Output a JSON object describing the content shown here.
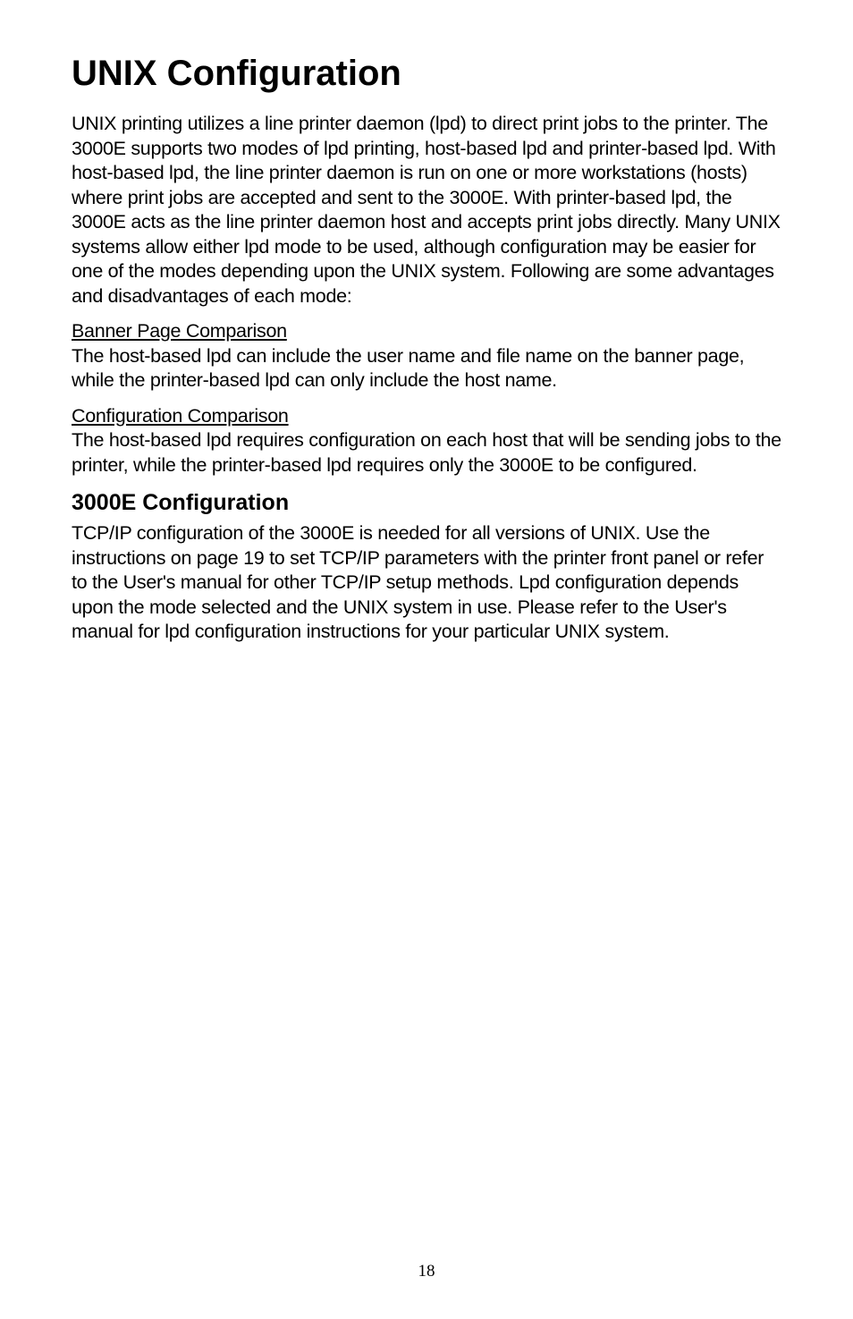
{
  "title": "UNIX Configuration",
  "intro": "UNIX printing utilizes a line printer daemon (lpd) to direct print jobs to the printer.  The 3000E supports two modes of lpd printing, host-based lpd and printer-based lpd.  With host-based lpd, the line printer daemon is run on one or more workstations (hosts) where print jobs are accepted and sent to the 3000E.  With printer-based lpd, the 3000E acts as the line printer daemon host and accepts print jobs directly.  Many UNIX systems allow either lpd mode to be used, although configuration may be easier for one of the modes depending upon the UNIX system.  Following are some advantages and disadvantages of each mode:",
  "banner_heading": "Banner Page Comparison",
  "banner_body": "The host-based lpd can include the user name and file name on the banner page, while the printer-based lpd can only include the host name.",
  "config_heading": "Configuration Comparison",
  "config_body": "The host-based lpd requires configuration on each host that will be sending jobs to the printer, while the printer-based lpd requires only the 3000E to be configured.",
  "subtitle": "3000E Configuration",
  "sub_body": "TCP/IP configuration of the 3000E is needed for all versions of UNIX. Use the instructions on page 19 to set TCP/IP parameters with the printer front panel or refer to the User's manual for other TCP/IP setup methods. Lpd configuration depends upon the mode selected and the UNIX system in use.  Please refer to the User's manual for lpd configuration instructions for your particular UNIX system.",
  "page_number": "18"
}
